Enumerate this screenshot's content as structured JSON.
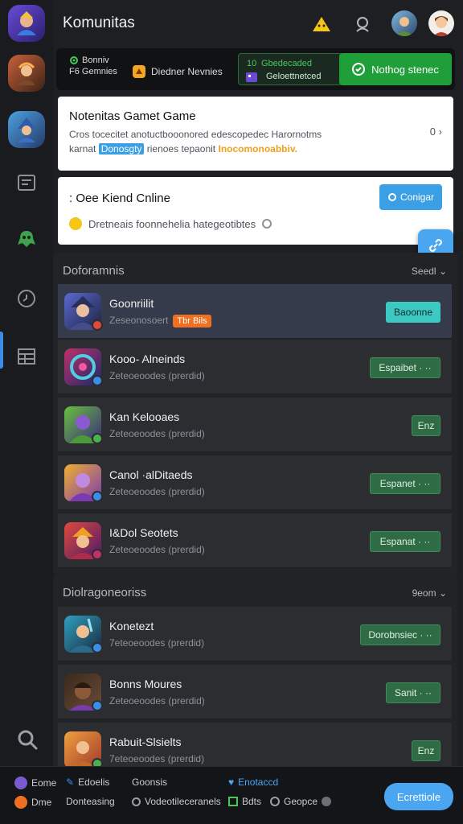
{
  "header": {
    "title": "Komunitas"
  },
  "banner": {
    "line_a1": "Bonniv",
    "line_a2": "F6 Gemnies",
    "label_b": "Diedner Nevnies",
    "num_c": "10",
    "label_c1": "Gbedecaded",
    "label_c2": "Geloettnetced",
    "button": "Nothog stenec"
  },
  "card1": {
    "title": "Notenitas Gamet Game",
    "desc_1": "Cros tocecitet anotuctbooonored edescopedec Harornotms",
    "desc_2_pre": "karnat",
    "desc_2_chip": "Donosgty",
    "desc_2_mid": "rienoes tepaonit",
    "desc_2_hl": "Inocomonoabbiv.",
    "count": "0"
  },
  "card2": {
    "title": ": Oee Kiend Cnline",
    "desc": "Dretneais foonnehelia hategeotibtes",
    "button": "Conigar"
  },
  "section1": {
    "title": "Doforamnis",
    "sort": "Seedl",
    "rows": [
      {
        "name": "Goonriilit",
        "sub": "Zeseonosoert",
        "tag": "Tbr Bils",
        "action": "Baoonne"
      },
      {
        "name": "Kooo- Alneinds",
        "sub": "Zeteoeoodes (prerdid)",
        "action": "Espaibet · ··"
      },
      {
        "name": "Kan Kelooaes",
        "sub": "Zeteoeoodes (prerdid)",
        "action": "Enz"
      },
      {
        "name": "Canol ·alDitaeds",
        "sub": "Zeteoeoodes (prerdid)",
        "action": "Espanet · ··"
      },
      {
        "name": "I&Dol Seotets",
        "sub": "Zeteoeoodes (prerdid)",
        "action": "Espanat · ··"
      }
    ]
  },
  "section2": {
    "title": "Diolragoneoriss",
    "sort": "9eom",
    "rows": [
      {
        "name": "Konetezt",
        "sub": "7eteoeoodes (prerdid)",
        "action": "Dorobnsiec · ··"
      },
      {
        "name": "Bonns Moures",
        "sub": "Zeteoeoodes (prerdid)",
        "action": "Sanit · ··"
      },
      {
        "name": "Rabuit-Slsielts",
        "sub": "7eteoeoodes (prerdid)",
        "action": "Enz"
      }
    ]
  },
  "bottom": {
    "i1": "Eome",
    "i2": "Edoelis",
    "i3": "Goonsis",
    "i4": "Enotaccd",
    "i5": "Dme",
    "i6": "Donteasing",
    "i7": "Vodeotileceranels",
    "i8": "Bdts",
    "i9": "Geopce",
    "button": "Ecrettiole"
  }
}
